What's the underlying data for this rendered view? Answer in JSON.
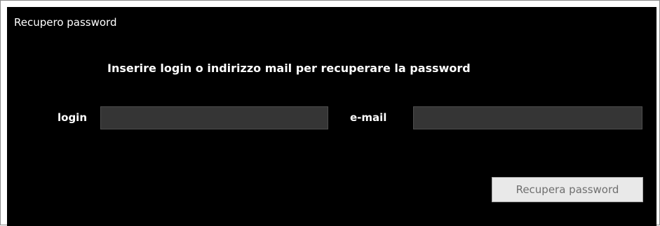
{
  "panel": {
    "title": "Recupero password",
    "instructions": "Inserire login o indirizzo mail per recuperare la password"
  },
  "form": {
    "login_label": "login",
    "login_value": "",
    "email_label": "e-mail",
    "email_value": "",
    "submit_label": "Recupera password"
  },
  "colors": {
    "panel_background": "#000000",
    "text": "#ffffff",
    "input_background": "#353535",
    "button_background": "#e9e9e9",
    "button_text": "#6f6f6f"
  }
}
